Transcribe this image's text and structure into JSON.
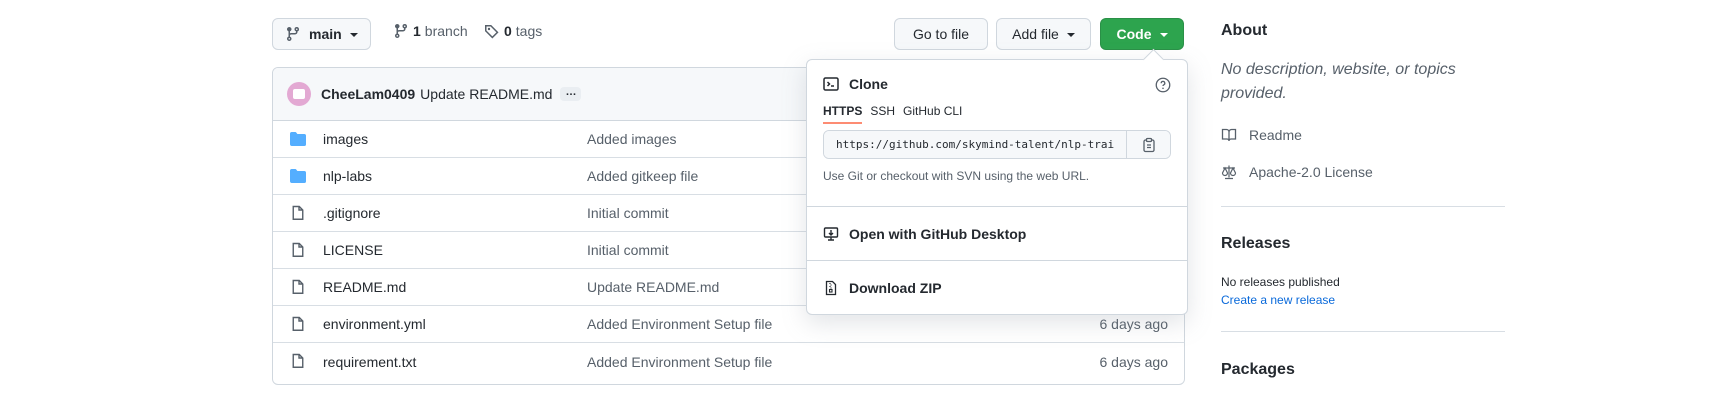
{
  "toolbar": {
    "branch_selector": "main",
    "branches_count": "1",
    "branches_label": "branch",
    "tags_count": "0",
    "tags_label": "tags",
    "go_to_file": "Go to file",
    "add_file": "Add file",
    "code": "Code"
  },
  "commit": {
    "author": "CheeLam0409",
    "message": "Update README.md",
    "ellipsis": "…"
  },
  "files": [
    {
      "type": "folder",
      "name": "images",
      "message": "Added images",
      "age": ""
    },
    {
      "type": "folder",
      "name": "nlp-labs",
      "message": "Added gitkeep file",
      "age": ""
    },
    {
      "type": "file",
      "name": ".gitignore",
      "message": "Initial commit",
      "age": ""
    },
    {
      "type": "file",
      "name": "LICENSE",
      "message": "Initial commit",
      "age": ""
    },
    {
      "type": "file",
      "name": "README.md",
      "message": "Update README.md",
      "age": ""
    },
    {
      "type": "file",
      "name": "environment.yml",
      "message": "Added Environment Setup file",
      "age": "6 days ago"
    },
    {
      "type": "file",
      "name": "requirement.txt",
      "message": "Added Environment Setup file",
      "age": "6 days ago"
    }
  ],
  "clone_menu": {
    "title": "Clone",
    "tabs": [
      "HTTPS",
      "SSH",
      "GitHub CLI"
    ],
    "active_tab": "HTTPS",
    "url": "https://github.com/skymind-talent/nlp-training.git",
    "hint": "Use Git or checkout with SVN using the web URL.",
    "open_desktop": "Open with GitHub Desktop",
    "download_zip": "Download ZIP"
  },
  "about": {
    "heading": "About",
    "description": "No description, website, or topics provided.",
    "readme": "Readme",
    "license": "Apache-2.0 License"
  },
  "releases": {
    "heading": "Releases",
    "none": "No releases published",
    "create_link": "Create a new release"
  },
  "packages": {
    "heading": "Packages"
  },
  "colors": {
    "code_button": "#2da44e",
    "folder_icon": "#54aeff",
    "link": "#0969da",
    "active_tab_underline": "#fd8c73"
  }
}
